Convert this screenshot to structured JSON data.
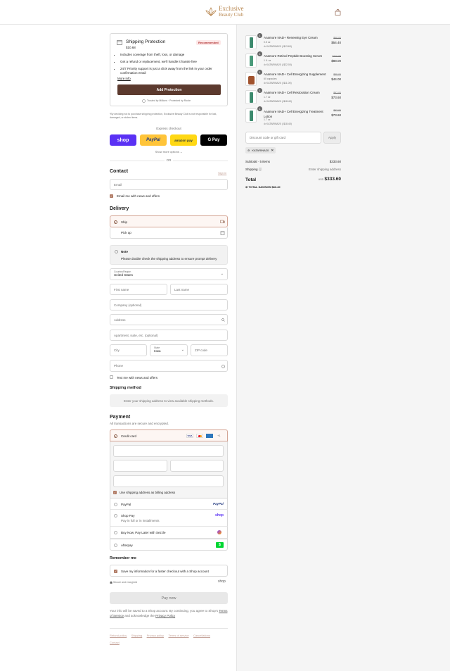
{
  "brand": {
    "line1": "Exclusive",
    "line2": "Beauty Club"
  },
  "protection": {
    "title": "Shipping Protection",
    "price": "$10.68",
    "badge": "Recommended",
    "bullets": [
      "Includes coverage from theft, loss, or damage",
      "Get a refund or replacement, we'll handle it hassle free",
      "24/7 Priority support is just a click away from the link in your order confirmation email"
    ],
    "more_info": "More info",
    "add_button": "Add Protection",
    "trusted": "Trusted by Millions · Protected by Route",
    "disclaimer": "*By deciding not to purchase shipping protection, Exclusive Beauty Club is not responsible for lost, damaged, or stolen items."
  },
  "express": {
    "title": "Express checkout",
    "shop": "shop",
    "paypal": "PayPal",
    "amazon": "amazon pay",
    "gpay": "G Pay",
    "more": "Show more options",
    "or": "OR"
  },
  "contact": {
    "title": "Contact",
    "signin": "Sign in",
    "email_placeholder": "Email",
    "news": "Email me with news and offers"
  },
  "delivery": {
    "title": "Delivery",
    "ship": "Ship",
    "pickup": "Pick up",
    "note_title": "Note",
    "note_body": "Please double check the shipping address to ensure prompt delivery",
    "country_label": "Country/Region",
    "country": "United States",
    "first_name": "First name",
    "last_name": "Last name",
    "company": "Company (optional)",
    "address": "Address",
    "apartment": "Apartment, suite, etc. (optional)",
    "city": "City",
    "state_label": "State",
    "state": "Iowa",
    "zip": "ZIP code",
    "phone": "Phone",
    "text_news": "Text me with news and offers"
  },
  "shipping_method": {
    "title": "Shipping method",
    "body": "Enter your shipping address to view available shipping methods."
  },
  "payment": {
    "title": "Payment",
    "subtitle": "All transactions are secure and encrypted.",
    "credit_card": "Credit card",
    "more_cards": "+1",
    "billing": "Use shipping address as billing address",
    "paypal": "PayPal",
    "paypal_logo": "PayPal",
    "shoppay": "Shop Pay",
    "shoppay_sub": "Pay in full or in installments",
    "shoppay_logo": "shop",
    "sezzle": "Buy Now, Pay Later with Sezzle",
    "afterpay": "Afterpay"
  },
  "remember": {
    "title": "Remember me",
    "save": "Save my information for a faster checkout with a Shop account",
    "secure": "Secure and encrypted",
    "shop": "shop"
  },
  "pay_now": "Pay now",
  "terms": {
    "line1": "Your info will be saved to a Shop account. By continuing, you agree to Shop's",
    "tos": "Terms of Service",
    "and": "and acknowledge the",
    "privacy": "Privacy Policy"
  },
  "footer": [
    "Refund policy",
    "Shipping",
    "Privacy policy",
    "Terms of service",
    "Cancellations",
    "Contact"
  ],
  "cart": {
    "items": [
      {
        "qty": "1",
        "name": "Anamore NAD+ Renewing Eye Cream",
        "variant": "0.5 oz",
        "discount": "KATARINA20 (-$13.60)",
        "old": "$68.00",
        "price": "$54.40"
      },
      {
        "qty": "1",
        "name": "Anamore Retinol Peptide Boosting Serum",
        "variant": "1 fl. oz",
        "discount": "KATARINA20 (-$22.00)",
        "old": "$110.00",
        "price": "$88.00"
      },
      {
        "qty": "1",
        "name": "Anamore NAD+ Cell Energizing Supplement",
        "variant": "60 capsules",
        "discount": "KATARINA20 (-$11.00)",
        "old": "$55.00",
        "price": "$44.00"
      },
      {
        "qty": "1",
        "name": "Anamore NAD+ Cell Restoration Cream",
        "variant": "1.7 oz",
        "discount": "KATARINA20 (-$18.40)",
        "old": "$92.00",
        "price": "$73.60"
      },
      {
        "qty": "1",
        "name": "Anamore NAD+ Cell Energizing Treatment Lotion",
        "variant": "1.7 oz",
        "discount": "KATARINA20 (-$18.40)",
        "old": "$92.00",
        "price": "$73.60"
      }
    ],
    "discount_placeholder": "Discount code or gift card",
    "apply": "Apply",
    "code": "KATARINA20",
    "subtotal_label": "Subtotal · 5 items",
    "subtotal": "$333.60",
    "shipping_label": "Shipping",
    "shipping_value": "Enter shipping address",
    "total_label": "Total",
    "currency": "USD",
    "total": "$333.60",
    "savings_label": "TOTAL SAVINGS",
    "savings": "$83.40"
  }
}
